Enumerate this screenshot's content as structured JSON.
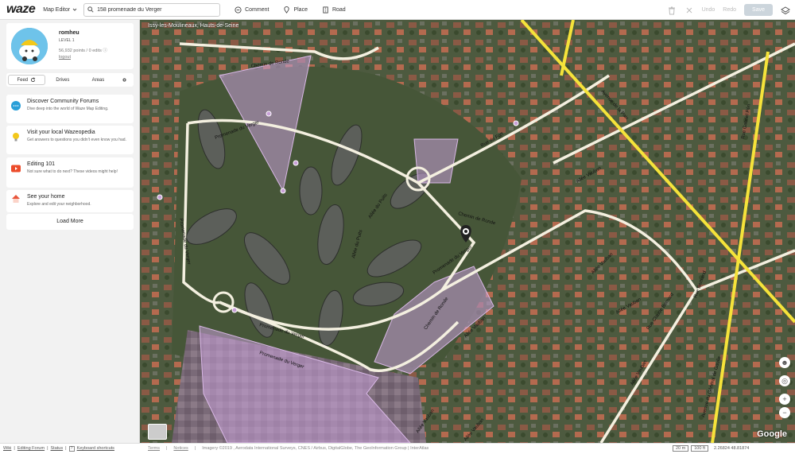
{
  "topbar": {
    "logo": "waze",
    "app_menu": "Map Editor",
    "search_value": "158 promenade du Verger",
    "tools": {
      "comment": "Comment",
      "place": "Place",
      "road": "Road"
    },
    "undo": "Undo",
    "redo": "Redo",
    "save": "Save"
  },
  "profile": {
    "username": "romheu",
    "level": "LEVEL 1",
    "stats": "56,932 points / 0 edits",
    "logout": "logout"
  },
  "tabs": {
    "feed": "Feed",
    "drives": "Drives",
    "areas": "Areas"
  },
  "cards": [
    {
      "title": "Discover Community Forums",
      "desc": "Dive deep into the world of Waze Map Editing.",
      "icon": "chat-icon",
      "color": "#2a9fd8"
    },
    {
      "title": "Visit your local Wazeopedia",
      "desc": "Get answers to questions you didn't even know you had.",
      "icon": "bulb-icon",
      "color": "#f3c81a"
    },
    {
      "title": "Editing 101",
      "desc": "Not sure what to do next? These videos might help!",
      "icon": "video-icon",
      "color": "#ec4c2b"
    },
    {
      "title": "See your home",
      "desc": "Explore and edit your neighborhood.",
      "icon": "home-icon",
      "color": "#e8553b"
    }
  ],
  "load_more": "Load More",
  "map": {
    "location": "Issy-les-Moulineaux, Hauts-de-Seine",
    "google": "Google",
    "road_labels": [
      "Chemin de Ronde",
      "Promenade du Verger",
      "Rue du Fort",
      "Avenue de la Paix",
      "Rue Gabriel Péri",
      "Allée du Puits",
      "Chemin de Ronde",
      "Promenade du Verger",
      "Allée Vauban",
      "Rue Claude Bernard",
      "Avenue du Général de Gaulle",
      "Allée du Puits",
      "Chemin de Ronde",
      "Allée Vauban",
      "Allée Vauban",
      "Promenade du Verger",
      "Promenade du Verger",
      "Allée Vauban",
      "Rue Bertrand",
      "Allée Vauban",
      "Allée Vauban",
      "Allée Vauban",
      "Promenade du Verger"
    ]
  },
  "footer": {
    "wiki": "Wiki",
    "forum": "Editing Forum",
    "status": "Status",
    "shortcuts": "Keyboard shortcuts",
    "terms": "Terms",
    "notices": "Notices",
    "imagery": "Imagery ©2019 , Aerodata International Surveys, CNES / Airbus, DigitalGlobe, The GeoInformation Group | InterAtlas",
    "scale_m": "20 m",
    "scale_ft": "100 ft",
    "coords": "2.26824 48.81874"
  },
  "colors": {
    "major_road": "#f5e33a",
    "street": "#f4f0e0",
    "place_area": "#c8a0d8",
    "satellite": "#5f6a52"
  }
}
